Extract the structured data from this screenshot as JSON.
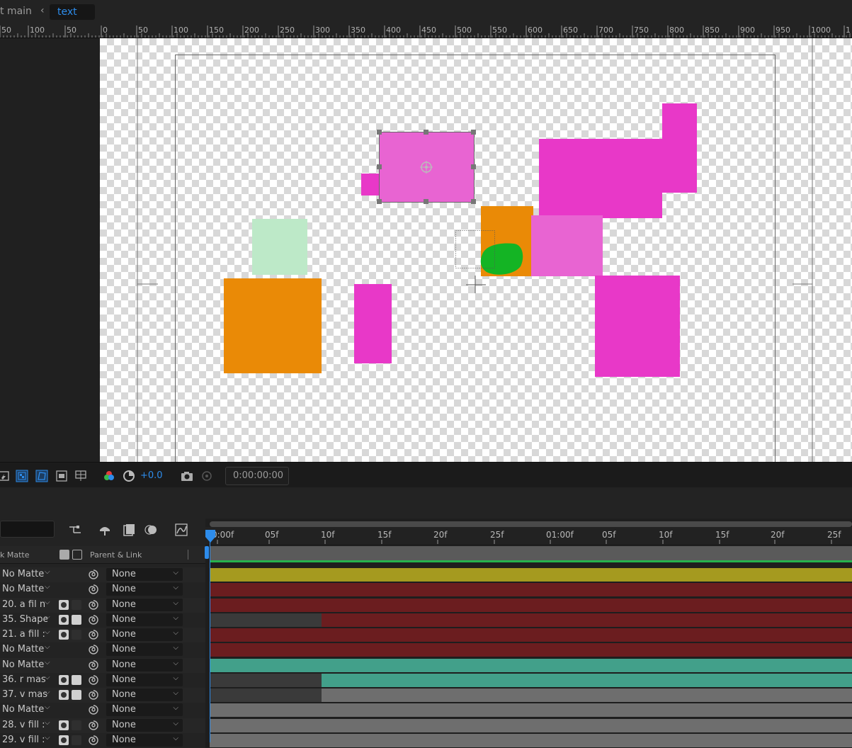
{
  "breadcrumb": {
    "comp_main": "t main",
    "comp_text": "text"
  },
  "ruler": {
    "labels": [
      "50",
      "100",
      "50",
      "0",
      "50",
      "100",
      "150",
      "200",
      "250",
      "300",
      "350",
      "400",
      "450",
      "500",
      "550",
      "600",
      "650",
      "700",
      "750",
      "800",
      "850",
      "900",
      "950",
      "1000",
      "1"
    ]
  },
  "viewer_toolbar": {
    "exposure": "+0.0",
    "timecode": "0:00:00:00"
  },
  "timeline": {
    "columns": {
      "track_matte": "k Matte",
      "parent_link": "Parent & Link"
    },
    "ruler_labels": [
      "0:00f",
      "05f",
      "10f",
      "15f",
      "20f",
      "25f",
      "01:00f",
      "05f",
      "10f",
      "15f",
      "20f",
      "25f"
    ],
    "layers": [
      {
        "matte": "No Matte",
        "switch_a": "",
        "switch_b": "",
        "parent": "None",
        "bar_color": "#a59a1f"
      },
      {
        "matte": "No Matte",
        "switch_a": "",
        "switch_b": "",
        "parent": "None",
        "bar_color": "#6b1d1f"
      },
      {
        "matte": "20. a fil n",
        "switch_a": "solid",
        "switch_b": "empty",
        "parent": "None",
        "bar_color": "#6b1d1f"
      },
      {
        "matte": "35. Shape",
        "switch_a": "solid",
        "switch_b": "matte",
        "parent": "None",
        "bar_color": "#6b1d1f"
      },
      {
        "matte": "21. a fill :",
        "switch_a": "solid",
        "switch_b": "empty",
        "parent": "None",
        "bar_color": "#6b1d1f"
      },
      {
        "matte": "No Matte",
        "switch_a": "",
        "switch_b": "",
        "parent": "None",
        "bar_color": "#6b1d1f"
      },
      {
        "matte": "No Matte",
        "switch_a": "",
        "switch_b": "",
        "parent": "None",
        "bar_color": "#42a08a"
      },
      {
        "matte": "36. r mas",
        "switch_a": "solid",
        "switch_b": "matte",
        "parent": "None",
        "bar_color": "#42a08a"
      },
      {
        "matte": "37. v mas",
        "switch_a": "solid",
        "switch_b": "matte",
        "parent": "None",
        "bar_color": "#6e6e6e"
      },
      {
        "matte": "No Matte",
        "switch_a": "",
        "switch_b": "",
        "parent": "None",
        "bar_color": "#6e6e6e"
      },
      {
        "matte": "28. v fill :",
        "switch_a": "solid",
        "switch_b": "empty",
        "parent": "None",
        "bar_color": "#6e6e6e"
      },
      {
        "matte": "29. v fill :",
        "switch_a": "solid",
        "switch_b": "empty",
        "parent": "None",
        "bar_color": "#6e6e6e"
      }
    ]
  },
  "colors": {
    "accent": "#2d8ceb",
    "magenta": "#e838c8",
    "pink": "#e864d2",
    "orange": "#ea8a06",
    "mint": "#bde9c8",
    "green": "#14b424"
  },
  "icons": [
    "fast-preview-icon",
    "transparency-grid-icon",
    "mask-visibility-icon",
    "region-of-interest-icon",
    "guides-icon",
    "channel-icon",
    "reset-exposure-icon",
    "snapshot-icon",
    "show-snapshot-icon",
    "solo-icon",
    "shy-icon",
    "frame-blending-icon",
    "motion-blur-icon",
    "graph-editor-icon",
    "parent-pickwhip-icon"
  ]
}
